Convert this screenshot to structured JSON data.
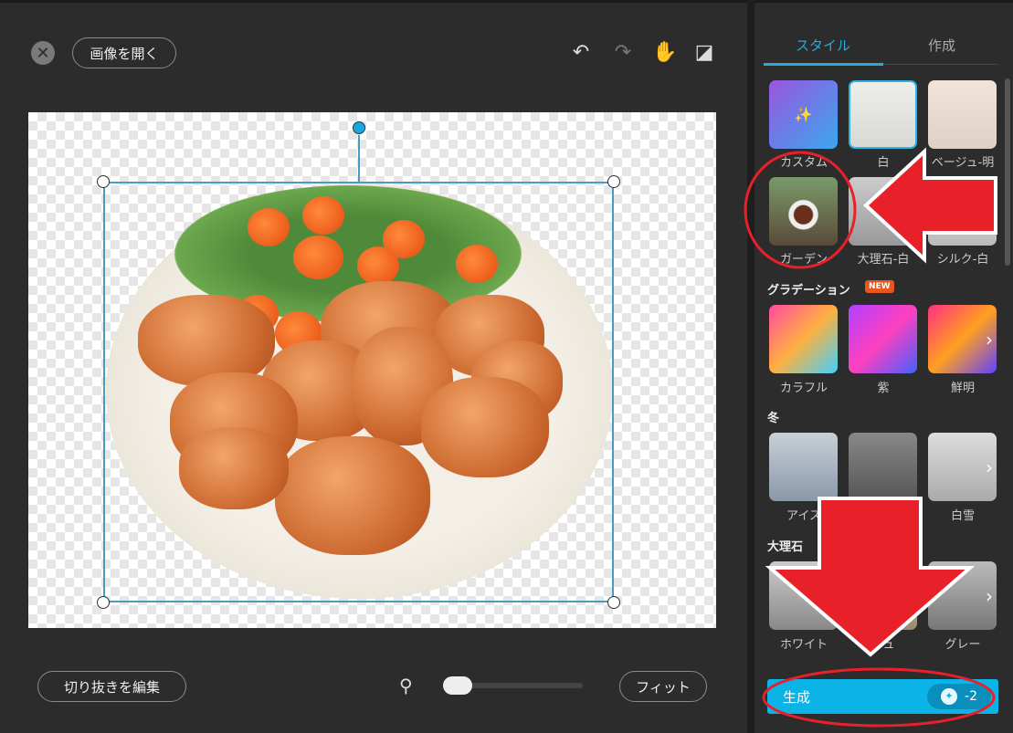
{
  "editor": {
    "open_image_label": "画像を開く",
    "edit_cutout_label": "切り抜きを編集",
    "fit_label": "フィット",
    "toolbar_icons": [
      "undo-icon",
      "redo-icon",
      "hand-icon",
      "eraser-icon"
    ]
  },
  "panel": {
    "tabs": [
      {
        "label": "スタイル",
        "active": true
      },
      {
        "label": "作成",
        "active": false
      }
    ],
    "styles": [
      {
        "label": "カスタム"
      },
      {
        "label": "白",
        "selected": true
      },
      {
        "label": "ベージュ-明"
      },
      {
        "label": "ガーデン"
      },
      {
        "label": "大理石-白"
      },
      {
        "label": "シルク-白"
      }
    ],
    "gradient": {
      "title": "グラデーション",
      "badge": "NEW",
      "items": [
        {
          "label": "カラフル"
        },
        {
          "label": "紫"
        },
        {
          "label": "鮮明"
        }
      ]
    },
    "winter": {
      "title": "冬",
      "items": [
        {
          "label": "アイス"
        },
        {
          "label": ""
        },
        {
          "label": "白雪"
        }
      ]
    },
    "marble": {
      "title": "大理石",
      "items": [
        {
          "label": "ホワイト"
        },
        {
          "label": "ジュ"
        },
        {
          "label": "グレー"
        }
      ]
    },
    "generate": {
      "label": "生成",
      "cost": "-2"
    }
  },
  "colors": {
    "accent": "#0bb3e6",
    "annotation": "#e8202a"
  }
}
